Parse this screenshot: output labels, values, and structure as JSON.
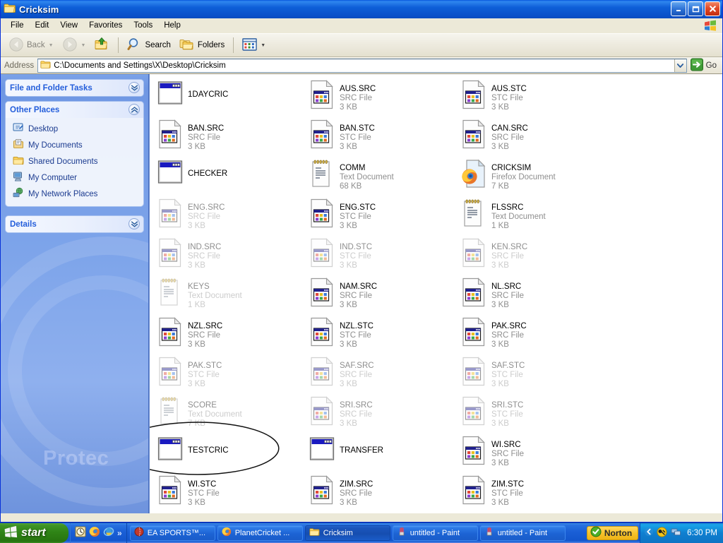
{
  "window": {
    "title": "Cricksim",
    "title_icon": "folder-icon",
    "minimize_label": "Minimize",
    "maximize_label": "Maximize",
    "close_label": "Close"
  },
  "menubar": {
    "items": [
      {
        "label": "File"
      },
      {
        "label": "Edit"
      },
      {
        "label": "View"
      },
      {
        "label": "Favorites"
      },
      {
        "label": "Tools"
      },
      {
        "label": "Help"
      }
    ]
  },
  "toolbar": {
    "back_label": "Back",
    "forward_label": "",
    "up_label": "",
    "search_label": "Search",
    "folders_label": "Folders",
    "views_label": ""
  },
  "address": {
    "label": "Address",
    "value": "C:\\Documents and Settings\\X\\Desktop\\Cricksim",
    "go_label": "Go"
  },
  "taskpane": {
    "watermark": "Protec",
    "panels": [
      {
        "title": "File and Folder Tasks",
        "state": "collapsed",
        "chevron": "chevron-down-icon"
      },
      {
        "title": "Other Places",
        "state": "expanded",
        "chevron": "chevron-up-icon"
      },
      {
        "title": "Details",
        "state": "collapsed",
        "chevron": "chevron-down-icon"
      }
    ],
    "other_places": [
      {
        "label": "Desktop",
        "icon": "desktop-icon"
      },
      {
        "label": "My Documents",
        "icon": "my-documents-icon"
      },
      {
        "label": "Shared Documents",
        "icon": "shared-documents-icon"
      },
      {
        "label": "My Computer",
        "icon": "my-computer-icon"
      },
      {
        "label": "My Network Places",
        "icon": "my-network-places-icon"
      }
    ]
  },
  "files": [
    {
      "name": "1DAYCRIC",
      "type": "",
      "size": "",
      "icon": "application-icon",
      "ghost": false
    },
    {
      "name": "AUS.SRC",
      "type": "SRC File",
      "size": "3 KB",
      "icon": "src-file-icon",
      "ghost": false
    },
    {
      "name": "AUS.STC",
      "type": "STC File",
      "size": "3 KB",
      "icon": "src-file-icon",
      "ghost": false
    },
    {
      "name": "BAN.SRC",
      "type": "SRC File",
      "size": "3 KB",
      "icon": "src-file-icon",
      "ghost": false
    },
    {
      "name": "BAN.STC",
      "type": "STC File",
      "size": "3 KB",
      "icon": "src-file-icon",
      "ghost": false
    },
    {
      "name": "CAN.SRC",
      "type": "SRC File",
      "size": "3 KB",
      "icon": "src-file-icon",
      "ghost": false
    },
    {
      "name": "CHECKER",
      "type": "",
      "size": "",
      "icon": "application-icon",
      "ghost": false
    },
    {
      "name": "COMM",
      "type": "Text Document",
      "size": "68 KB",
      "icon": "text-document-icon",
      "ghost": false
    },
    {
      "name": "CRICKSIM",
      "type": "Firefox Document",
      "size": "7 KB",
      "icon": "firefox-document-icon",
      "ghost": false
    },
    {
      "name": "ENG.SRC",
      "type": "SRC File",
      "size": "3 KB",
      "icon": "src-file-icon",
      "ghost": true
    },
    {
      "name": "ENG.STC",
      "type": "STC File",
      "size": "3 KB",
      "icon": "src-file-icon",
      "ghost": false
    },
    {
      "name": "FLSSRC",
      "type": "Text Document",
      "size": "1 KB",
      "icon": "text-document-icon",
      "ghost": false
    },
    {
      "name": "IND.SRC",
      "type": "SRC File",
      "size": "3 KB",
      "icon": "src-file-icon",
      "ghost": true
    },
    {
      "name": "IND.STC",
      "type": "STC File",
      "size": "3 KB",
      "icon": "src-file-icon",
      "ghost": true
    },
    {
      "name": "KEN.SRC",
      "type": "SRC File",
      "size": "3 KB",
      "icon": "src-file-icon",
      "ghost": true
    },
    {
      "name": "KEYS",
      "type": "Text Document",
      "size": "1 KB",
      "icon": "text-document-icon",
      "ghost": true
    },
    {
      "name": "NAM.SRC",
      "type": "SRC File",
      "size": "3 KB",
      "icon": "src-file-icon",
      "ghost": false
    },
    {
      "name": "NL.SRC",
      "type": "SRC File",
      "size": "3 KB",
      "icon": "src-file-icon",
      "ghost": false
    },
    {
      "name": "NZL.SRC",
      "type": "SRC File",
      "size": "3 KB",
      "icon": "src-file-icon",
      "ghost": false
    },
    {
      "name": "NZL.STC",
      "type": "STC File",
      "size": "3 KB",
      "icon": "src-file-icon",
      "ghost": false
    },
    {
      "name": "PAK.SRC",
      "type": "SRC File",
      "size": "3 KB",
      "icon": "src-file-icon",
      "ghost": false
    },
    {
      "name": "PAK.STC",
      "type": "STC File",
      "size": "3 KB",
      "icon": "src-file-icon",
      "ghost": true
    },
    {
      "name": "SAF.SRC",
      "type": "SRC File",
      "size": "3 KB",
      "icon": "src-file-icon",
      "ghost": true
    },
    {
      "name": "SAF.STC",
      "type": "STC File",
      "size": "3 KB",
      "icon": "src-file-icon",
      "ghost": true
    },
    {
      "name": "SCORE",
      "type": "Text Document",
      "size": "7 KB",
      "icon": "text-document-icon",
      "ghost": true
    },
    {
      "name": "SRI.SRC",
      "type": "SRC File",
      "size": "3 KB",
      "icon": "src-file-icon",
      "ghost": true
    },
    {
      "name": "SRI.STC",
      "type": "STC File",
      "size": "3 KB",
      "icon": "src-file-icon",
      "ghost": true
    },
    {
      "name": "TESTCRIC",
      "type": "",
      "size": "",
      "icon": "application-icon",
      "ghost": false
    },
    {
      "name": "TRANSFER",
      "type": "",
      "size": "",
      "icon": "application-icon",
      "ghost": false
    },
    {
      "name": "WI.SRC",
      "type": "SRC File",
      "size": "3 KB",
      "icon": "src-file-icon",
      "ghost": false
    },
    {
      "name": "WI.STC",
      "type": "STC File",
      "size": "3 KB",
      "icon": "src-file-icon",
      "ghost": false
    },
    {
      "name": "ZIM.SRC",
      "type": "SRC File",
      "size": "3 KB",
      "icon": "src-file-icon",
      "ghost": false
    },
    {
      "name": "ZIM.STC",
      "type": "STC File",
      "size": "3 KB",
      "icon": "src-file-icon",
      "ghost": false
    }
  ],
  "annotation": {
    "shape": "ellipse",
    "target": "TESTCRIC",
    "color": "#000000"
  },
  "taskbar": {
    "start_label": "start",
    "quicklaunch": [
      {
        "icon": "clock-icon"
      },
      {
        "icon": "firefox-icon"
      },
      {
        "icon": "internet-explorer-icon"
      }
    ],
    "quicklaunch_more": "»",
    "tasks": [
      {
        "label": "EA SPORTS™...",
        "icon": "cricket-ball-icon",
        "active": false
      },
      {
        "label": "PlanetCricket ...",
        "icon": "firefox-icon",
        "active": false
      },
      {
        "label": "Cricksim",
        "icon": "folder-icon",
        "active": true
      },
      {
        "label": "untitled - Paint",
        "icon": "paint-icon",
        "active": false
      },
      {
        "label": "untitled - Paint",
        "icon": "paint-icon",
        "active": false
      }
    ],
    "norton_label": "Norton",
    "norton_icon": "norton-check-icon",
    "tray": [
      {
        "icon": "show-hidden-icons-icon"
      },
      {
        "icon": "norton-tray-icon"
      },
      {
        "icon": "network-icon"
      }
    ],
    "clock": "6:30 PM"
  },
  "colors": {
    "titlebar_blue": "#0a50c8",
    "taskbar_blue": "#1a5fd6",
    "start_green": "#2f8416",
    "accent_link": "#245edb",
    "norton_yellow": "#f7c32b"
  }
}
